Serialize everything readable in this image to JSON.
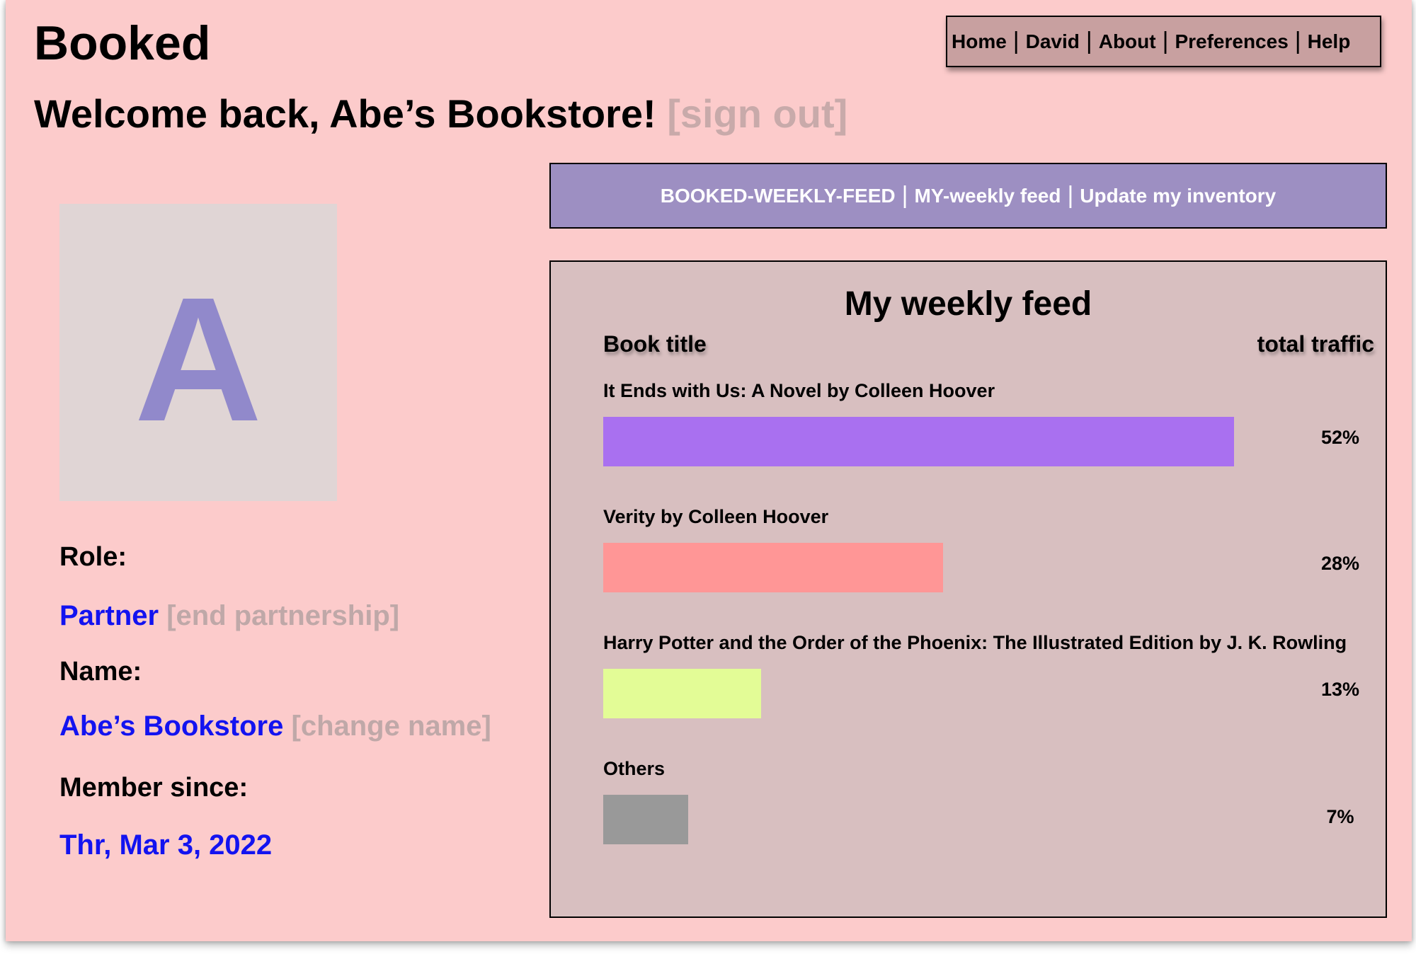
{
  "app": {
    "title": "Booked"
  },
  "nav": {
    "items": [
      {
        "label": "Home"
      },
      {
        "label": "David"
      },
      {
        "label": "About"
      },
      {
        "label": "Preferences"
      },
      {
        "label": "Help"
      }
    ]
  },
  "welcome": {
    "greeting": "Welcome back, Abe’s Bookstore!",
    "sign_out": "[sign out]"
  },
  "feed_nav": {
    "items": [
      {
        "label": "BOOKED-WEEKLY-FEED"
      },
      {
        "label": "MY-weekly feed"
      },
      {
        "label": "Update my inventory"
      }
    ]
  },
  "profile": {
    "avatar_letter": "A",
    "role_label": "Role:",
    "role_value": "Partner",
    "role_action": "[end partnership]",
    "name_label": "Name:",
    "name_value": "Abe’s Bookstore",
    "name_action": "[change name]",
    "member_label": "Member since:",
    "member_value": "Thr, Mar 3, 2022"
  },
  "feed": {
    "title": "My weekly feed",
    "col_title": "Book title",
    "col_traffic": "total traffic",
    "rows": [
      {
        "title": "It Ends with Us: A Novel by Colleen Hoover",
        "value": 52,
        "pct": "52%",
        "color": "#a970f0"
      },
      {
        "title": "Verity by Colleen Hoover",
        "value": 28,
        "pct": "28%",
        "color": "#ff9696"
      },
      {
        "title": "Harry Potter and the Order of the Phoenix: The Illustrated Edition by J. K. Rowling",
        "value": 13,
        "pct": "13%",
        "color": "#e3fc96"
      },
      {
        "title": "Others",
        "value": 7,
        "pct": "7%",
        "color": "#999999"
      }
    ]
  }
}
